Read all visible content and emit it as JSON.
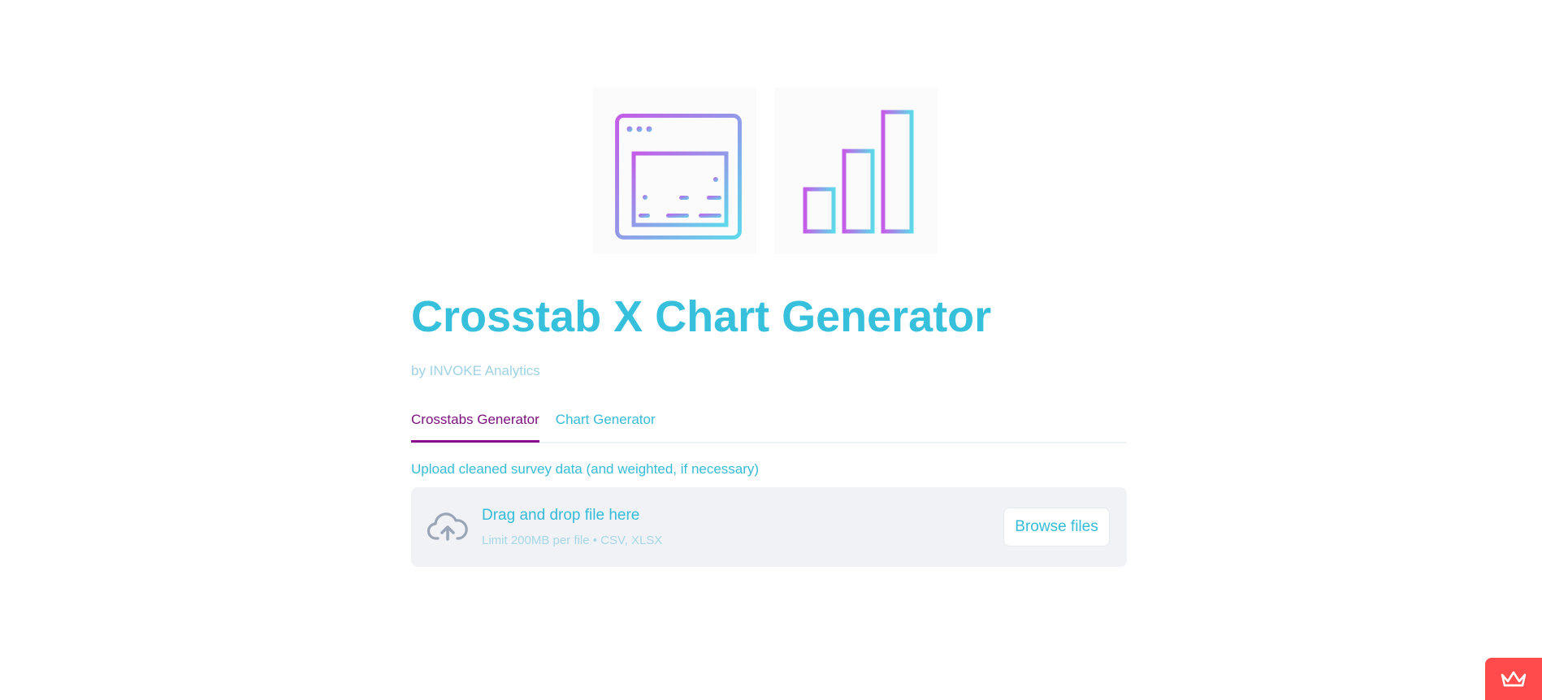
{
  "header": {
    "title": "Crosstab X Chart Generator",
    "subtitle": "by INVOKE Analytics"
  },
  "hero_icons": [
    "spreadsheet-icon",
    "bar-chart-icon"
  ],
  "tabs": [
    {
      "label": "Crosstabs Generator",
      "active": true
    },
    {
      "label": "Chart Generator",
      "active": false
    }
  ],
  "uploader": {
    "label": "Upload cleaned survey data (and weighted, if necessary)",
    "drag_text": "Drag and drop file here",
    "limit_text": "Limit 200MB per file • CSV, XLSX",
    "browse_label": "Browse files",
    "icon": "cloud-upload-icon"
  },
  "footer_badge": {
    "icon": "streamlit-crown-icon"
  },
  "colors": {
    "accent": "#36c0dc",
    "tab_active": "#8a0e8c",
    "gradient_start": "#c45de8",
    "gradient_end": "#5fd8ea",
    "badge": "#ff4b4b"
  }
}
